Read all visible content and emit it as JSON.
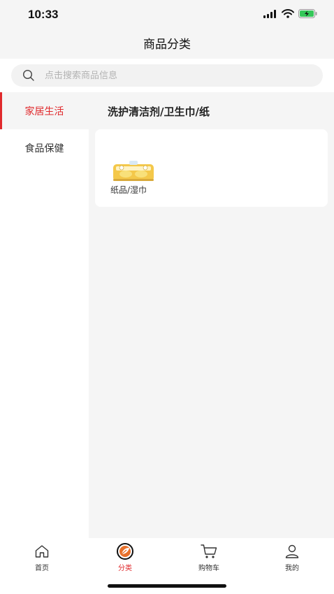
{
  "status_bar": {
    "time": "10:33"
  },
  "nav": {
    "title": "商品分类"
  },
  "search": {
    "placeholder": "点击搜索商品信息"
  },
  "sidebar": {
    "items": [
      {
        "label": "家居生活",
        "active": true
      },
      {
        "label": "食品保健",
        "active": false
      }
    ]
  },
  "content": {
    "category_title": "洗护清洁剂/卫生巾/纸",
    "products": [
      {
        "label": "纸品/湿巾"
      }
    ]
  },
  "tab_bar": {
    "tabs": [
      {
        "label": "首页",
        "icon": "home-icon",
        "active": false
      },
      {
        "label": "分类",
        "icon": "category-icon",
        "active": true
      },
      {
        "label": "购物车",
        "icon": "cart-icon",
        "active": false
      },
      {
        "label": "我的",
        "icon": "user-icon",
        "active": false
      }
    ]
  },
  "colors": {
    "accent": "#e0292c",
    "background": "#f5f5f5",
    "surface": "#ffffff"
  }
}
